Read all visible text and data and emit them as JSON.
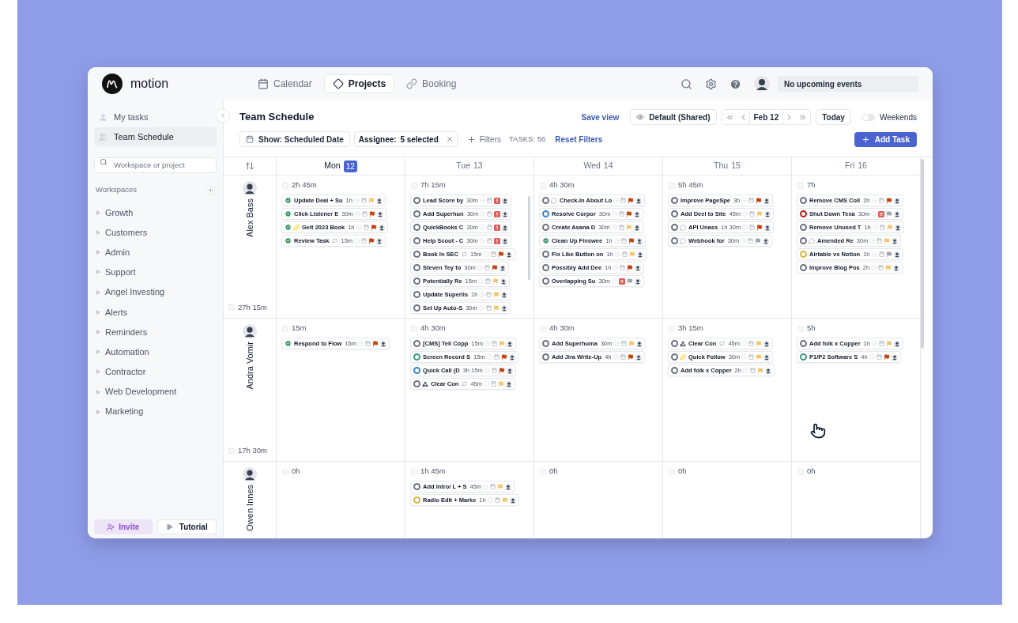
{
  "app": {
    "logo_text": "motion"
  },
  "nav_tabs": [
    {
      "label": "Calendar",
      "selected": false
    },
    {
      "label": "Projects",
      "selected": true
    },
    {
      "label": "Booking",
      "selected": false
    }
  ],
  "top_right": {
    "events": "No upcoming events"
  },
  "sidebar": {
    "views": [
      {
        "label": "My tasks",
        "kind": "single",
        "selected": false
      },
      {
        "label": "Team Schedule",
        "kind": "team",
        "selected": true
      }
    ],
    "search_placeholder": "Workspace or project",
    "workspaces_heading": "Workspaces",
    "workspaces": [
      "Growth",
      "Customers",
      "Admin",
      "Support",
      "Angel Investing",
      "Alerts",
      "Reminders",
      "Automation",
      "Contractor",
      "Web Development",
      "Marketing"
    ],
    "invite": "Invite",
    "tutorial": "Tutorial"
  },
  "toolbar": {
    "title": "Team Schedule",
    "save_view": "Save view",
    "view": "Default (Shared)",
    "date": "Feb 12",
    "today": "Today",
    "weekends": {
      "label": "Weekends",
      "on": false
    },
    "show_filter": "Show: Scheduled Date",
    "assignee_filter": {
      "label": "Assignee:",
      "value": "5 selected"
    },
    "filters": "Filters",
    "task_count": "TASKS: 56",
    "reset": "Reset Filters",
    "add_task": "Add Task"
  },
  "days": [
    {
      "name": "Mon",
      "date": "12",
      "today": true
    },
    {
      "name": "Tue",
      "date": "13",
      "today": false
    },
    {
      "name": "Wed",
      "date": "14",
      "today": false
    },
    {
      "name": "Thu",
      "date": "15",
      "today": false
    },
    {
      "name": "Fri",
      "date": "16",
      "today": false
    }
  ],
  "people": [
    {
      "name": "Alex Bass",
      "total": "27h 15m",
      "days": [
        {
          "total": "2h 45m",
          "tasks": [
            {
              "title": "Update Deal + Su",
              "duration": "1h",
              "done": true,
              "flag": {
                "kind": "flag",
                "color": "#f2c66d"
              }
            },
            {
              "title": "Click Listener E",
              "duration": "30m",
              "done": true,
              "flag": {
                "kind": "flag",
                "color": "#c2410c"
              }
            },
            {
              "title": "Gelt 2023 Book",
              "prefix": {
                "kind": "sparkle"
              },
              "duration": "1h",
              "done": true,
              "flag": {
                "kind": "flag",
                "color": "#c2410c"
              }
            },
            {
              "title": "Review Task",
              "recurring": true,
              "duration": "15m",
              "done": true,
              "flag": {
                "kind": "flag",
                "color": "#c2410c"
              }
            }
          ]
        },
        {
          "total": "7h 15m",
          "tasks": [
            {
              "title": "Lead Score by",
              "duration": "30m",
              "done": false,
              "color": "#6b7280",
              "flag": {
                "kind": "urgent"
              }
            },
            {
              "title": "Add Superhun",
              "duration": "30m",
              "done": false,
              "color": "#6b7280",
              "flag": {
                "kind": "urgent"
              }
            },
            {
              "title": "QuickBooks C",
              "duration": "30m",
              "done": false,
              "color": "#6b7280",
              "flag": {
                "kind": "urgent"
              }
            },
            {
              "title": "Help Scout - C",
              "duration": "30m",
              "done": false,
              "color": "#6b7280",
              "flag": {
                "kind": "urgent"
              }
            },
            {
              "title": "Book In SEC",
              "recurring": true,
              "duration": "15m",
              "done": false,
              "color": "#6b7280",
              "flag": {
                "kind": "flag",
                "color": "#c2410c"
              }
            },
            {
              "title": "Steven Tey to",
              "duration": "30m",
              "done": false,
              "color": "#6b7280",
              "flag": {
                "kind": "flag",
                "color": "#c2410c"
              }
            },
            {
              "title": "Potentially Re",
              "duration": "15m",
              "done": false,
              "color": "#6b7280",
              "flag": {
                "kind": "flag",
                "color": "#f2c66d"
              }
            },
            {
              "title": "Update Superlis",
              "duration": "1h",
              "done": false,
              "color": "#6b7280",
              "flag": {
                "kind": "flag",
                "color": "#f2c66d"
              }
            },
            {
              "title": "Set Up Auto-S",
              "duration": "30m",
              "done": false,
              "color": "#6b7280",
              "flag": {
                "kind": "flag",
                "color": "#f2c66d"
              }
            }
          ]
        },
        {
          "total": "4h 30m",
          "tasks": [
            {
              "title": "Check-In About Lo",
              "prefix": {
                "kind": "chat"
              },
              "done": false,
              "color": "#6b7280",
              "flag": {
                "kind": "flag",
                "color": "#c2410c"
              }
            },
            {
              "title": "Resolve Corpor",
              "duration": "30m",
              "done": false,
              "color": "#3b82c4",
              "flag": {
                "kind": "flag",
                "color": "#c2410c"
              }
            },
            {
              "title": "Create Asana D",
              "duration": "30m",
              "done": false,
              "color": "#6b7280",
              "flag": {
                "kind": "flag",
                "color": "#f2c66d"
              }
            },
            {
              "title": "Clean Up Finswee",
              "duration": "1h",
              "done": true,
              "flag": {
                "kind": "flag",
                "color": "#c2410c"
              }
            },
            {
              "title": "Fix Like Button on",
              "duration": "1h",
              "done": false,
              "color": "#6b7280",
              "flag": {
                "kind": "flag",
                "color": "#f2c66d"
              }
            },
            {
              "title": "Possibly Add Dee",
              "duration": "1h",
              "done": false,
              "color": "#6b7280",
              "flag": {
                "kind": "flag",
                "color": "#c2410c"
              }
            },
            {
              "title": "Overlapping Su",
              "duration": "30m",
              "done": false,
              "color": "#6b7280",
              "overdue": true,
              "flag": {
                "kind": "flag",
                "color": "#9ca3af"
              }
            }
          ]
        },
        {
          "total": "5h 45m",
          "tasks": [
            {
              "title": "Improve PageSpe",
              "duration": "3h",
              "done": false,
              "color": "#6b7280",
              "flag": {
                "kind": "flag",
                "color": "#c2410c"
              }
            },
            {
              "title": "Add Deel to Site",
              "duration": "45m",
              "done": false,
              "color": "#6b7280",
              "flag": {
                "kind": "flag",
                "color": "#f2c66d"
              }
            },
            {
              "title": "API Unass",
              "prefix": {
                "kind": "chat"
              },
              "duration": "1h 30m",
              "done": false,
              "color": "#6b7280",
              "flag": {
                "kind": "flag",
                "color": "#c2410c"
              }
            },
            {
              "title": "Webhook for",
              "prefix": {
                "kind": "chat"
              },
              "duration": "30m",
              "done": false,
              "color": "#6b7280",
              "flag": {
                "kind": "flag",
                "color": "#9ca3af"
              }
            }
          ]
        },
        {
          "total": "7h",
          "tasks": [
            {
              "title": "Remove CMS Coll",
              "duration": "2h",
              "done": false,
              "color": "#6b7280",
              "flag": {
                "kind": "flag",
                "color": "#c2410c"
              }
            },
            {
              "title": "Shut Down Texa",
              "duration": "30m",
              "done": false,
              "color": "#b91c1c",
              "overdue": true,
              "flag": {
                "kind": "flag",
                "color": "#9ca3af"
              }
            },
            {
              "title": "Remove Unused T",
              "duration": "1h",
              "done": false,
              "color": "#6b7280",
              "flag": {
                "kind": "flag",
                "color": "#f2c66d"
              }
            },
            {
              "title": "Amended Re",
              "prefix": {
                "kind": "chat"
              },
              "duration": "30m",
              "done": false,
              "color": "#6b7280",
              "flag": {
                "kind": "flag",
                "color": "#f2c66d"
              }
            },
            {
              "title": "Airtable vs Notion",
              "duration": "1h",
              "done": false,
              "color": "#d4b83a",
              "flag": {
                "kind": "flag",
                "color": "#9ca3af"
              }
            },
            {
              "title": "Improve Blog Pos",
              "duration": "2h",
              "done": false,
              "color": "#6b7280",
              "flag": {
                "kind": "flag",
                "color": "#f2c66d"
              }
            }
          ]
        }
      ]
    },
    {
      "name": "Andra Vomir",
      "total": "17h 30m",
      "days": [
        {
          "total": "15m",
          "tasks": [
            {
              "title": "Respond to Flow",
              "duration": "15m",
              "done": true,
              "flag": {
                "kind": "flag",
                "color": "#c2410c"
              }
            }
          ]
        },
        {
          "total": "4h 30m",
          "tasks": [
            {
              "title": "[CMS] Tell Copp",
              "duration": "15m",
              "done": false,
              "color": "#6b7280",
              "flag": {
                "kind": "flag",
                "color": "#f2c66d"
              }
            },
            {
              "title": "Screen Record S",
              "duration": "15m",
              "done": false,
              "color": "#3a9b84",
              "flag": {
                "kind": "flag",
                "color": "#c2410c"
              }
            },
            {
              "title": "Quick Call (D",
              "duration": "3h 15m",
              "done": false,
              "color": "#3b82c4",
              "flag": {
                "kind": "flag",
                "color": "#c2410c"
              }
            },
            {
              "title": "Clear Con",
              "prefix": {
                "kind": "shapes"
              },
              "recurring": true,
              "duration": "45m",
              "done": false,
              "color": "#6b7280",
              "flag": {
                "kind": "flag",
                "color": "#f2c66d"
              }
            }
          ]
        },
        {
          "total": "4h 30m",
          "tasks": [
            {
              "title": "Add Superhuma",
              "duration": "30m",
              "done": false,
              "color": "#6b7280",
              "flag": {
                "kind": "flag",
                "color": "#f2c66d"
              }
            },
            {
              "title": "Add Jira Write-Up",
              "duration": "4h",
              "done": false,
              "color": "#6b7280",
              "flag": {
                "kind": "flag",
                "color": "#c2410c"
              }
            }
          ]
        },
        {
          "total": "3h 15m",
          "tasks": [
            {
              "title": "Clear Con",
              "prefix": {
                "kind": "shapes"
              },
              "recurring": true,
              "duration": "45m",
              "done": false,
              "color": "#6b7280",
              "flag": {
                "kind": "flag",
                "color": "#f2c66d"
              }
            },
            {
              "title": "Quick Follow",
              "prefix": {
                "kind": "sparkle"
              },
              "duration": "30m",
              "done": false,
              "color": "#6b7280",
              "flag": {
                "kind": "flag",
                "color": "#f2c66d"
              }
            },
            {
              "title": "Add folk x Copper",
              "duration": "2h",
              "done": false,
              "color": "#6b7280",
              "flag": {
                "kind": "flag",
                "color": "#f2c66d"
              }
            }
          ]
        },
        {
          "total": "5h",
          "tasks": [
            {
              "title": "Add folk x Copper",
              "duration": "1h",
              "done": false,
              "color": "#6b7280",
              "flag": {
                "kind": "flag",
                "color": "#f2c66d"
              }
            },
            {
              "title": "P1/P2 Software S",
              "duration": "4h",
              "done": false,
              "color": "#3a9b84",
              "flag": {
                "kind": "flag",
                "color": "#c2410c"
              }
            }
          ]
        }
      ]
    },
    {
      "name": "Owen Innes",
      "days": [
        {
          "total": "0h"
        },
        {
          "total": "1h 45m",
          "tasks": [
            {
              "title": "Add Intro/ L + S",
              "duration": "45m",
              "done": false,
              "color": "#6b7280",
              "flag": {
                "kind": "flag",
                "color": "#f2c66d"
              }
            },
            {
              "title": "Radio Edit + Marke",
              "duration": "1h",
              "done": false,
              "color": "#d4b83a",
              "flag": {
                "kind": "flag",
                "color": "#f2c66d"
              }
            }
          ]
        },
        {
          "total": "0h"
        },
        {
          "total": "0h"
        },
        {
          "total": "0h"
        }
      ]
    }
  ]
}
